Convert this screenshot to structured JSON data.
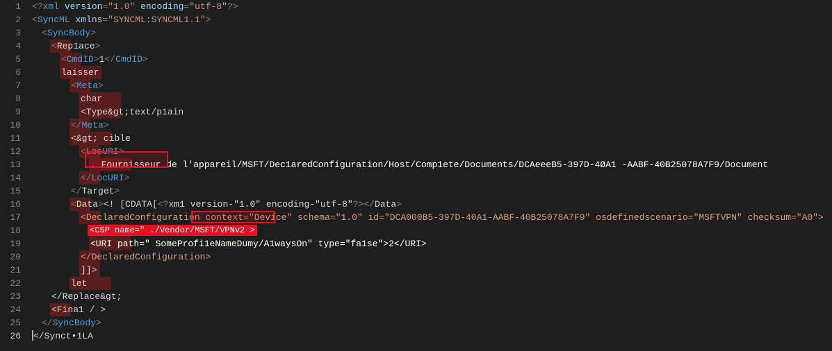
{
  "lines": {
    "1": {
      "indent": 0,
      "segs": [
        {
          "t": "<?",
          "c": "delim"
        },
        {
          "t": "xml",
          "c": "tag"
        },
        {
          "t": " ",
          "c": "text"
        },
        {
          "t": "version",
          "c": "attr-name"
        },
        {
          "t": "=",
          "c": "delim"
        },
        {
          "t": "\"1.0\"",
          "c": "attr-val"
        },
        {
          "t": " ",
          "c": "text"
        },
        {
          "t": "encoding",
          "c": "attr-name"
        },
        {
          "t": "=",
          "c": "delim"
        },
        {
          "t": "\"utf-8\"",
          "c": "attr-val"
        },
        {
          "t": "?>",
          "c": "delim"
        }
      ]
    },
    "2": {
      "indent": 0,
      "segs": [
        {
          "t": "<",
          "c": "delim"
        },
        {
          "t": "SyncML",
          "c": "tag"
        },
        {
          "t": " ",
          "c": "text"
        },
        {
          "t": "xmlns",
          "c": "attr-name"
        },
        {
          "t": "=",
          "c": "delim"
        },
        {
          "t": "\"SYNCML:SYNCML1.1\"",
          "c": "attr-val"
        },
        {
          "t": ">",
          "c": "delim"
        }
      ]
    },
    "3": {
      "indent": 1,
      "segs": [
        {
          "t": "<",
          "c": "delim"
        },
        {
          "t": "SyncBody",
          "c": "tag"
        },
        {
          "t": ">",
          "c": "delim"
        }
      ]
    },
    "4": {
      "indent": 2,
      "segs": [
        {
          "t": "<",
          "c": "delim"
        },
        {
          "t": "Rep1ace",
          "c": "text"
        },
        {
          "t": ">",
          "c": "delim"
        }
      ],
      "modWidth": 30
    },
    "5": {
      "indent": 3,
      "segs": [
        {
          "t": "<",
          "c": "delim"
        },
        {
          "t": "CmdID",
          "c": "tag"
        },
        {
          "t": ">",
          "c": "delim"
        },
        {
          "t": "1",
          "c": "text"
        },
        {
          "t": "</",
          "c": "delim"
        },
        {
          "t": "CmdID",
          "c": "tag"
        },
        {
          "t": ">",
          "c": "delim"
        }
      ],
      "modWidth": 30
    },
    "6": {
      "indent": 3,
      "segs": [
        {
          "t": "laisser",
          "c": "text"
        }
      ],
      "modWidth": 60
    },
    "7": {
      "indent": 4,
      "segs": [
        {
          "t": "<",
          "c": "delim"
        },
        {
          "t": "Meta",
          "c": "tag"
        },
        {
          "t": ">",
          "c": "delim"
        }
      ],
      "modWidth": 30
    },
    "8": {
      "indent": 5,
      "segs": [
        {
          "t": "char",
          "c": "text"
        }
      ],
      "modWidth": 60
    },
    "9": {
      "indent": 5,
      "segs": [
        {
          "t": "<Type&gt;text/p1ain",
          "c": "text"
        }
      ],
      "modWidth": 60
    },
    "10": {
      "indent": 4,
      "segs": [
        {
          "t": "</",
          "c": "delim"
        },
        {
          "t": "Meta",
          "c": "tag"
        },
        {
          "t": ">",
          "c": "delim"
        }
      ],
      "modWidth": 30
    },
    "11": {
      "indent": 4,
      "segs": [
        {
          "t": "<&gt; cible",
          "c": "text"
        }
      ],
      "modWidth": 60
    },
    "12": {
      "indent": 5,
      "segs": [
        {
          "t": "<",
          "c": "delim"
        },
        {
          "t": "LocURI",
          "c": "tag"
        },
        {
          "t": ">",
          "c": "delim"
        }
      ],
      "modWidth": 30
    },
    "13": {
      "indent": 6,
      "segs": [
        {
          "t": ". Fournisseur de l'appareil/MSFT/Dec1aredConfiguration/Host/Comp1ete/Documents/DCAeeeB5-397D-4ØA1 -AABF-40B25078A7F9/Document",
          "c": "white"
        }
      ],
      "modWidth": 60
    },
    "14": {
      "indent": 5,
      "segs": [
        {
          "t": "</",
          "c": "delim"
        },
        {
          "t": "LocURI",
          "c": "tag"
        },
        {
          "t": ">",
          "c": "delim"
        }
      ],
      "modWidth": 30
    },
    "15": {
      "indent": 4,
      "segs": [
        {
          "t": "</",
          "c": "delim"
        },
        {
          "t": "Target",
          "c": "text"
        },
        {
          "t": ">",
          "c": "delim"
        }
      ]
    },
    "16": {
      "indent": 4,
      "segs": [
        {
          "t": "<",
          "c": "delim"
        },
        {
          "t": "Data",
          "c": "text"
        },
        {
          "t": ">",
          "c": "delim"
        },
        {
          "t": "<! [CDATA[",
          "c": "text"
        },
        {
          "t": "<?",
          "c": "delim"
        },
        {
          "t": "xm1 version-\"1.0\" encoding-\"utf-8\"",
          "c": "text"
        },
        {
          "t": "?>",
          "c": "delim"
        },
        {
          "t": "</",
          "c": "delim"
        },
        {
          "t": "Data",
          "c": "text"
        },
        {
          "t": ">",
          "c": "delim"
        }
      ],
      "modWidth": 30
    },
    "17": {
      "indent": 5,
      "segs": [
        {
          "t": "<",
          "c": "orange"
        },
        {
          "t": "DeclaredConfiguration",
          "c": "orange"
        },
        {
          "t": " ",
          "c": "orange"
        },
        {
          "t": "context=\"Device\"",
          "c": "orange"
        },
        {
          "t": " ",
          "c": "orange"
        },
        {
          "t": "schema=\"1.0\" id=\"DCA000B5-397D-40A1-AABF-40B25078A7F9\" osdefinedscenario=\"MSFTVPN\" checksum=\"A0\">",
          "c": "orange"
        }
      ],
      "modWidth": 30
    },
    "18": {
      "indent": 6,
      "segs": [
        {
          "t": "",
          "c": "text"
        }
      ],
      "modWidth": 60
    },
    "19": {
      "indent": 6,
      "segs": [
        {
          "t": "<URI path=\" SomeProfi1eNameDumy/A1waysOn\" type=\"fa1se\">2</URI>",
          "c": "white"
        }
      ],
      "modWidth": 60
    },
    "20": {
      "indent": 5,
      "segs": [
        {
          "t": "</",
          "c": "orange"
        },
        {
          "t": "DeclaredConfiguration",
          "c": "orange"
        },
        {
          "t": ">",
          "c": "orange"
        }
      ],
      "modWidth": 30
    },
    "21": {
      "indent": 5,
      "segs": [
        {
          "t": "]]>",
          "c": "text"
        }
      ],
      "modWidth": 30
    },
    "22": {
      "indent": 4,
      "segs": [
        {
          "t": "let",
          "c": "text"
        }
      ],
      "modWidth": 60
    },
    "23": {
      "indent": 2,
      "segs": [
        {
          "t": "</Replace&gt;",
          "c": "text"
        }
      ]
    },
    "24": {
      "indent": 2,
      "segs": [
        {
          "t": "<Fina1 / >",
          "c": "text"
        }
      ],
      "modWidth": 30
    },
    "25": {
      "indent": 1,
      "segs": [
        {
          "t": "</",
          "c": "delim"
        },
        {
          "t": "SyncBody",
          "c": "tag"
        },
        {
          "t": ">",
          "c": "delim"
        }
      ]
    },
    "26": {
      "indent": 0,
      "segs": [
        {
          "t": "</Synct•1LA",
          "c": "text"
        }
      ],
      "current": true
    }
  },
  "highlights": {
    "box12": {
      "text": ""
    },
    "box17": {
      "text": "context=\"Device\""
    },
    "fill18": {
      "text": "<CSP name=\" ./Vendor/MSFT/VPNv2 >"
    }
  },
  "lineCount": 26
}
